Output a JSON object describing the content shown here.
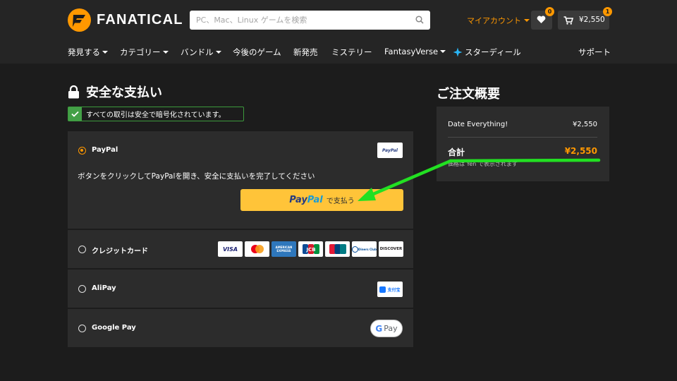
{
  "header": {
    "brand": "FANATICAL",
    "search": {
      "placeholder": "PC、Mac、Linux ゲームを検索"
    },
    "account_label": "マイアカウント",
    "wishlist_count": "0",
    "cart_count": "1",
    "cart_total": "¥2,550"
  },
  "nav": {
    "items": [
      {
        "label": "発見する",
        "dropdown": true
      },
      {
        "label": "カテゴリー",
        "dropdown": true
      },
      {
        "label": "バンドル",
        "dropdown": true
      },
      {
        "label": "今後のゲーム",
        "dropdown": false
      },
      {
        "label": "新発売",
        "dropdown": false
      },
      {
        "label": "ミステリー",
        "dropdown": false
      },
      {
        "label": "FantasyVerse",
        "dropdown": true
      },
      {
        "label": "スターディール",
        "dropdown": false,
        "icon": "star-deal-icon"
      }
    ],
    "support": "サポート"
  },
  "checkout": {
    "title": "安全な支払い",
    "secure_note": "すべての取引は安全で暗号化されています。",
    "methods": [
      {
        "name": "PayPal",
        "selected": true,
        "badge": "PayPal"
      },
      {
        "name": "クレジットカード",
        "selected": false,
        "cards": [
          "VISA",
          "Mastercard",
          "AMERICAN EXPRESS",
          "JCB",
          "UnionPay",
          "Diners Club",
          "DISCOVER"
        ]
      },
      {
        "name": "AliPay",
        "selected": false,
        "badge": "支付宝"
      },
      {
        "name": "Google Pay",
        "selected": false,
        "badge": "G Pay"
      }
    ],
    "paypal_instruction": "ボタンをクリックしてPayPalを開き、安全に支払いを完了してください",
    "paypal_button": {
      "brand_1": "Pay",
      "brand_2": "Pal",
      "suffix": "で支払う"
    }
  },
  "summary": {
    "title": "ご注文概要",
    "item_name": "Date Everything!",
    "item_price": "¥2,550",
    "total_label": "合計",
    "total_value": "¥2,550",
    "note": "価格は Yen で表示されます"
  },
  "colors": {
    "accent": "#ff9800",
    "background": "#1c1c1c",
    "panel": "#2c2c2c",
    "paypal_yellow": "#ffc439",
    "annotation_arrow": "#22e022"
  }
}
